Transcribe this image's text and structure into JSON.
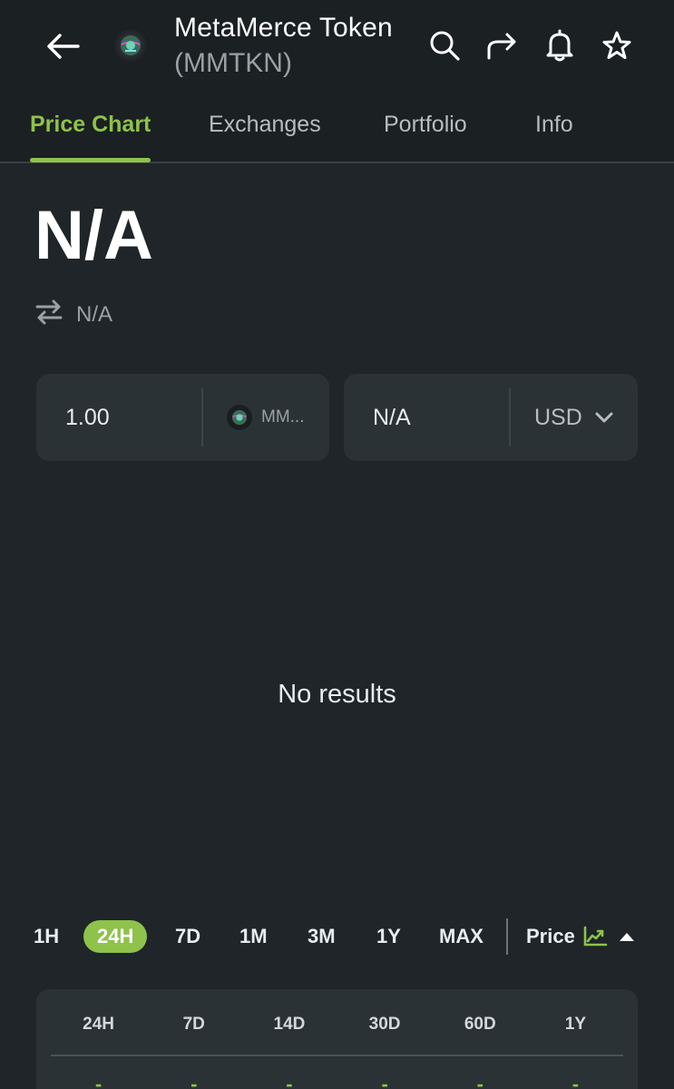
{
  "header": {
    "title": "MetaMerce Token",
    "subtitle": "(MMTKN)",
    "icons": [
      "back-arrow-icon",
      "token-logo",
      "search-icon",
      "share-icon",
      "bell-icon",
      "star-icon"
    ]
  },
  "tabs": [
    {
      "label": "Price Chart",
      "active": true
    },
    {
      "label": "Exchanges",
      "active": false
    },
    {
      "label": "Portfolio",
      "active": false
    },
    {
      "label": "Info",
      "active": false
    }
  ],
  "price": {
    "value": "N/A",
    "converted": "N/A"
  },
  "converter": {
    "amount": "1.00",
    "token_symbol": "MM...",
    "result": "N/A",
    "currency": "USD"
  },
  "chart": {
    "empty_message": "No results"
  },
  "ranges": [
    {
      "label": "1H",
      "active": false
    },
    {
      "label": "24H",
      "active": true
    },
    {
      "label": "7D",
      "active": false
    },
    {
      "label": "1M",
      "active": false
    },
    {
      "label": "3M",
      "active": false
    },
    {
      "label": "1Y",
      "active": false
    },
    {
      "label": "MAX",
      "active": false
    }
  ],
  "metric": {
    "label": "Price"
  },
  "performance": {
    "headers": [
      "24H",
      "7D",
      "14D",
      "30D",
      "60D",
      "1Y"
    ],
    "values": [
      "-",
      "-",
      "-",
      "-",
      "-",
      "-"
    ]
  },
  "colors": {
    "accent": "#8ec24a",
    "background": "#1f2528",
    "card": "#2a3235"
  }
}
